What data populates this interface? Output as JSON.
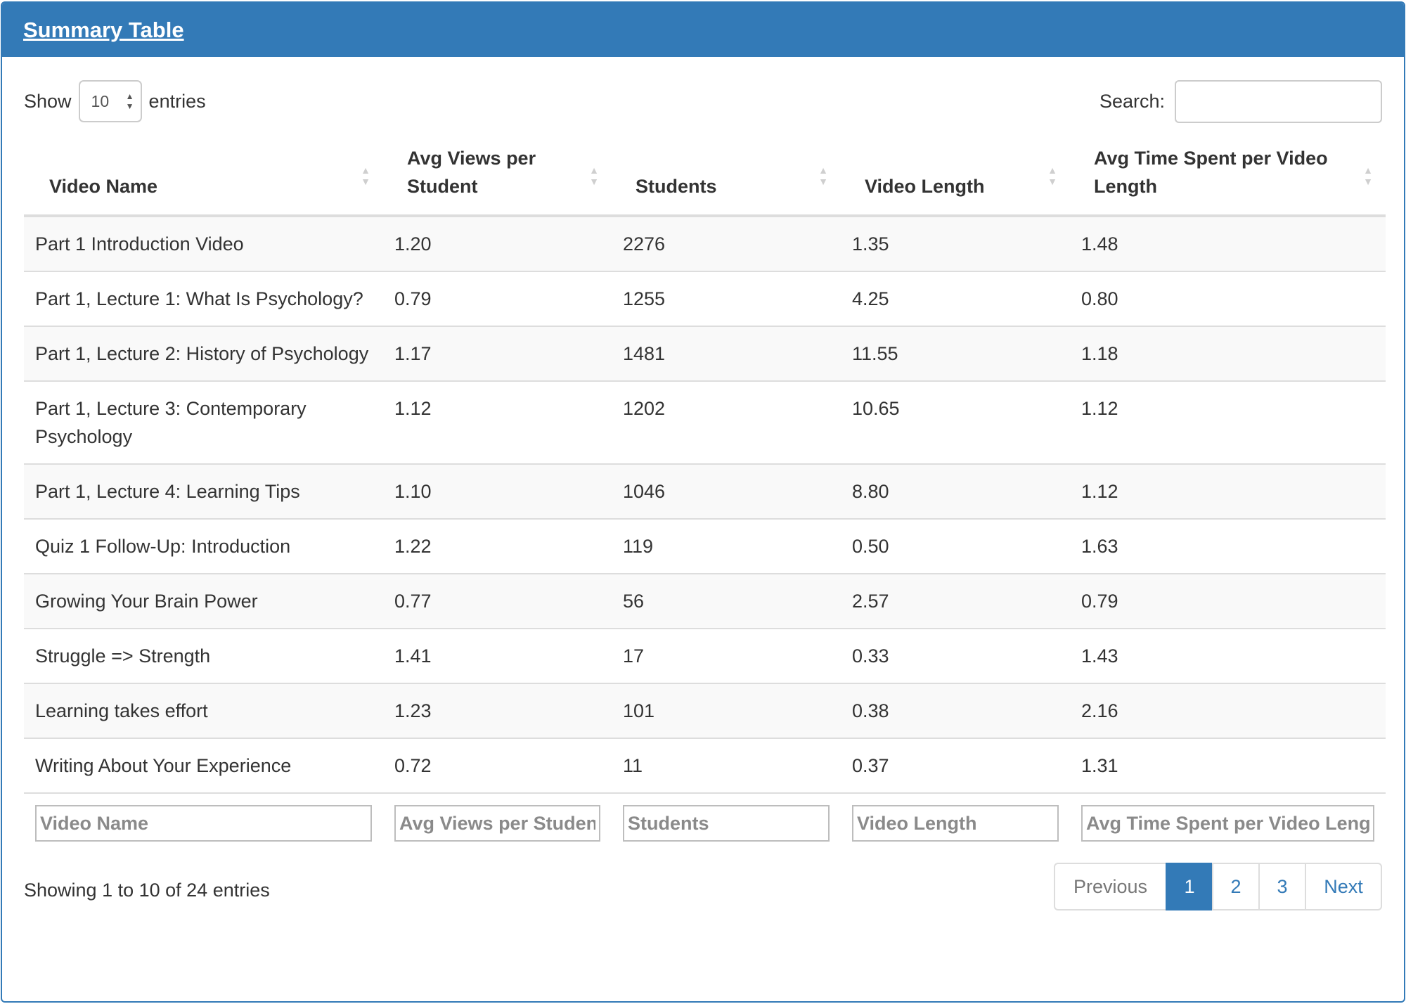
{
  "panel": {
    "title": "Summary Table"
  },
  "length": {
    "prefix": "Show",
    "value": "10",
    "suffix": "entries"
  },
  "search": {
    "label": "Search:",
    "value": ""
  },
  "columns": [
    "Video Name",
    "Avg Views per Student",
    "Students",
    "Video Length",
    "Avg Time Spent per Video Length"
  ],
  "rows": [
    [
      "Part 1 Introduction Video",
      "1.20",
      "2276",
      "1.35",
      "1.48"
    ],
    [
      "Part 1, Lecture 1: What Is Psychology?",
      "0.79",
      "1255",
      "4.25",
      "0.80"
    ],
    [
      "Part 1, Lecture 2: History of Psychology",
      "1.17",
      "1481",
      "11.55",
      "1.18"
    ],
    [
      "Part 1, Lecture 3: Contemporary Psychology",
      "1.12",
      "1202",
      "10.65",
      "1.12"
    ],
    [
      "Part 1, Lecture 4: Learning Tips",
      "1.10",
      "1046",
      "8.80",
      "1.12"
    ],
    [
      "Quiz 1 Follow-Up: Introduction",
      "1.22",
      "119",
      "0.50",
      "1.63"
    ],
    [
      "Growing Your Brain Power",
      "0.77",
      "56",
      "2.57",
      "0.79"
    ],
    [
      "Struggle => Strength",
      "1.41",
      "17",
      "0.33",
      "1.43"
    ],
    [
      "Learning takes effort",
      "1.23",
      "101",
      "0.38",
      "2.16"
    ],
    [
      "Writing About Your Experience",
      "0.72",
      "11",
      "0.37",
      "1.31"
    ]
  ],
  "footer_filters": [
    "Video Name",
    "Avg Views per Student",
    "Students",
    "Video Length",
    "Avg Time Spent per Video Length"
  ],
  "info": "Showing 1 to 10 of 24 entries",
  "pagination": {
    "previous": "Previous",
    "pages": [
      "1",
      "2",
      "3"
    ],
    "active": "1",
    "next": "Next"
  },
  "colors": {
    "primary": "#337ab7",
    "border": "#dddddd",
    "stripe": "#f9f9f9"
  }
}
